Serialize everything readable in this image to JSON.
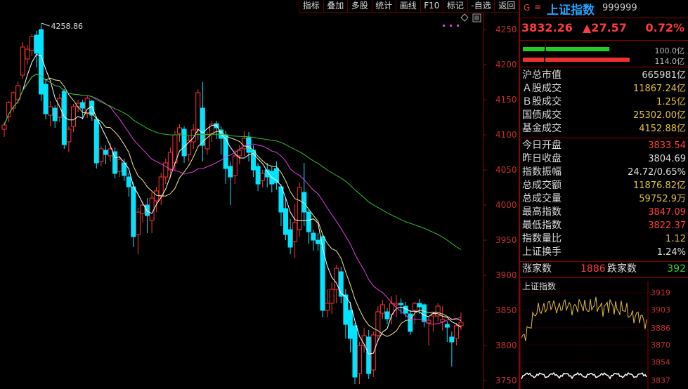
{
  "toolbar": [
    "指标",
    "叠加",
    "多股",
    "统计",
    "画线",
    "F10",
    "标记",
    "-自选",
    "返回"
  ],
  "main_chart": {
    "y_ticks": [
      4250,
      4200,
      4150,
      4100,
      4050,
      4000,
      3950,
      3900,
      3850,
      3800,
      3750
    ],
    "ylim": [
      3740,
      4272
    ],
    "max_label": "4258.86",
    "candles": [
      [
        4108,
        4114,
        4097,
        4118
      ],
      [
        4126,
        4146,
        4118,
        4148
      ],
      [
        4138,
        4160,
        4132,
        4162
      ],
      [
        4150,
        4170,
        4144,
        4176
      ],
      [
        4185,
        4225,
        4180,
        4232
      ],
      [
        4208,
        4222,
        4200,
        4228
      ],
      [
        4220,
        4240,
        4212,
        4244
      ],
      [
        4242,
        4216,
        4196,
        4248
      ],
      [
        4250,
        4158,
        4148,
        4258.86
      ],
      [
        4172,
        4130,
        4122,
        4180
      ],
      [
        4128,
        4140,
        4112,
        4148
      ],
      [
        4138,
        4120,
        4110,
        4142
      ],
      [
        4125,
        4152,
        4118,
        4158
      ],
      [
        4162,
        4086,
        4080,
        4165
      ],
      [
        4090,
        4108,
        4075,
        4112
      ],
      [
        4112,
        4140,
        4104,
        4144
      ],
      [
        4140,
        4145,
        4132,
        4150
      ],
      [
        4146,
        4138,
        4122,
        4150
      ],
      [
        4130,
        4152,
        4124,
        4156
      ],
      [
        4148,
        4128,
        4120,
        4150
      ],
      [
        4122,
        4060,
        4052,
        4126
      ],
      [
        4062,
        4080,
        4055,
        4084
      ],
      [
        4078,
        4072,
        4058,
        4085
      ],
      [
        4070,
        4080,
        4062,
        4088
      ],
      [
        4076,
        4045,
        4038,
        4082
      ],
      [
        4048,
        4065,
        4040,
        4070
      ],
      [
        4060,
        4042,
        4034,
        4066
      ],
      [
        4040,
        4026,
        4012,
        4046
      ],
      [
        4026,
        3955,
        3940,
        4032
      ],
      [
        3958,
        3990,
        3930,
        3996
      ],
      [
        3988,
        4000,
        3975,
        4005
      ],
      [
        4000,
        3985,
        3960,
        4010
      ],
      [
        3978,
        4010,
        3960,
        4018
      ],
      [
        4006,
        4020,
        3990,
        4026
      ],
      [
        4012,
        4040,
        4000,
        4046
      ],
      [
        4040,
        4060,
        4030,
        4066
      ],
      [
        4050,
        4075,
        4038,
        4082
      ],
      [
        4060,
        4100,
        4050,
        4105
      ],
      [
        4102,
        4110,
        4090,
        4115
      ],
      [
        4108,
        4070,
        4060,
        4112
      ],
      [
        4072,
        4092,
        4062,
        4098
      ],
      [
        4090,
        4107,
        4080,
        4115
      ],
      [
        4108,
        4160,
        4092,
        4165
      ],
      [
        4138,
        4085,
        4062,
        4175
      ],
      [
        4080,
        4100,
        4072,
        4105
      ],
      [
        4102,
        4115,
        4090,
        4120
      ],
      [
        4116,
        4110,
        4094,
        4120
      ],
      [
        4107,
        4095,
        4072,
        4112
      ],
      [
        4100,
        4052,
        4030,
        4105
      ],
      [
        4055,
        4040,
        4000,
        4062
      ],
      [
        4042,
        4070,
        4030,
        4078
      ],
      [
        4070,
        4078,
        4058,
        4085
      ],
      [
        4080,
        4095,
        4070,
        4105
      ],
      [
        4096,
        4075,
        4062,
        4104
      ],
      [
        4078,
        4050,
        4040,
        4085
      ],
      [
        4055,
        4030,
        4020,
        4060
      ],
      [
        4035,
        4045,
        4025,
        4050
      ],
      [
        4050,
        4040,
        4025,
        4060
      ],
      [
        4048,
        4030,
        4018,
        4055
      ],
      [
        4052,
        4032,
        4022,
        4062
      ],
      [
        4026,
        3990,
        3970,
        4030
      ],
      [
        3995,
        3958,
        3950,
        4010
      ],
      [
        3965,
        3940,
        3930,
        3980
      ],
      [
        3948,
        3975,
        3925,
        4002
      ],
      [
        3965,
        4025,
        3955,
        4032
      ],
      [
        4018,
        3990,
        3970,
        4060
      ],
      [
        3990,
        3962,
        3945,
        3995
      ],
      [
        3960,
        3950,
        3935,
        3965
      ],
      [
        3950,
        3945,
        3935,
        3960
      ],
      [
        3955,
        3850,
        3840,
        3958
      ],
      [
        3850,
        3860,
        3840,
        3880
      ],
      [
        3860,
        3880,
        3845,
        3890
      ],
      [
        3880,
        3910,
        3860,
        3915
      ],
      [
        3905,
        3870,
        3860,
        3912
      ],
      [
        3872,
        3830,
        3810,
        3880
      ],
      [
        3850,
        3810,
        3790,
        3862
      ],
      [
        3828,
        3755,
        3745,
        3832
      ],
      [
        3760,
        3800,
        3745,
        3805
      ],
      [
        3800,
        3814,
        3790,
        3825
      ],
      [
        3812,
        3760,
        3752,
        3822
      ],
      [
        3765,
        3815,
        3755,
        3820
      ],
      [
        3814,
        3848,
        3805,
        3856
      ],
      [
        3846,
        3858,
        3838,
        3865
      ],
      [
        3848,
        3838,
        3830,
        3853
      ],
      [
        3844,
        3860,
        3830,
        3870
      ],
      [
        3858,
        3860,
        3840,
        3872
      ],
      [
        3860,
        3858,
        3845,
        3867
      ],
      [
        3856,
        3846,
        3840,
        3862
      ],
      [
        3845,
        3820,
        3815,
        3850
      ],
      [
        3850,
        3860,
        3830,
        3862
      ],
      [
        3860,
        3855,
        3845,
        3866
      ],
      [
        3858,
        3834,
        3826,
        3860
      ],
      [
        3832,
        3836,
        3800,
        3840
      ],
      [
        3842,
        3845,
        3820,
        3848
      ],
      [
        3842,
        3856,
        3834,
        3860
      ],
      [
        3834,
        3837,
        3821,
        3856
      ],
      [
        3830,
        3826,
        3805,
        3835
      ],
      [
        3812,
        3805,
        3770,
        3820
      ],
      [
        3810,
        3828,
        3800,
        3832
      ],
      [
        3828,
        3833,
        3822,
        3847
      ]
    ]
  },
  "quote": {
    "name": "上证指数",
    "code": "999999",
    "g_label": "G",
    "eq_label": "≡",
    "price": "3832.26",
    "change": "▲27.57",
    "pct": "0.72%",
    "bar1_val": "100.0亿",
    "bar2_val": "114.0亿",
    "bar1_ratio": 0.88,
    "bar2_ratio": 0.98
  },
  "stats": [
    {
      "label": "沪总市值",
      "value": "665981亿",
      "color": "wht"
    },
    {
      "label": "Ａ股成交",
      "value": "11867.24亿",
      "color": "yel"
    },
    {
      "label": "Ｂ股成交",
      "value": "1.25亿",
      "color": "yel"
    },
    {
      "label": "国债成交",
      "value": "25302.00亿",
      "color": "yel"
    },
    {
      "label": "基金成交",
      "value": "4152.88亿",
      "color": "yel"
    },
    {
      "label": "今日开盘",
      "value": "3833.54",
      "color": "red"
    },
    {
      "label": "昨日收盘",
      "value": "3804.69",
      "color": "wht"
    },
    {
      "label": "指数振幅",
      "value": "24.72/0.65%",
      "color": "wht"
    },
    {
      "label": "总成交额",
      "value": "11876.82亿",
      "color": "yel"
    },
    {
      "label": "总成交量",
      "value": "59752.9万",
      "color": "yel"
    },
    {
      "label": "最高指数",
      "value": "3847.09",
      "color": "red"
    },
    {
      "label": "最低指数",
      "value": "3822.37",
      "color": "red"
    },
    {
      "label": "指数量比",
      "value": "1.12",
      "color": "yel"
    },
    {
      "label": "上证换手",
      "value": "1.24%",
      "color": "wht"
    }
  ],
  "updown": {
    "up_label": "涨家数",
    "up": "1886",
    "down_label": "跌家数",
    "down": "392"
  },
  "mini": {
    "title": "上证指数",
    "y_ticks": [
      "3919",
      "3903",
      "3886",
      "3870",
      "3854",
      "3837"
    ],
    "ylim": [
      3834,
      3922
    ]
  },
  "colors": {
    "up": "#ff3232",
    "down": "#00e5ff",
    "ma5": "#ffffff",
    "ma10": "#f0e68c",
    "ma20": "#e040e0",
    "ma60": "#30c030",
    "axis": "#8b0000"
  }
}
